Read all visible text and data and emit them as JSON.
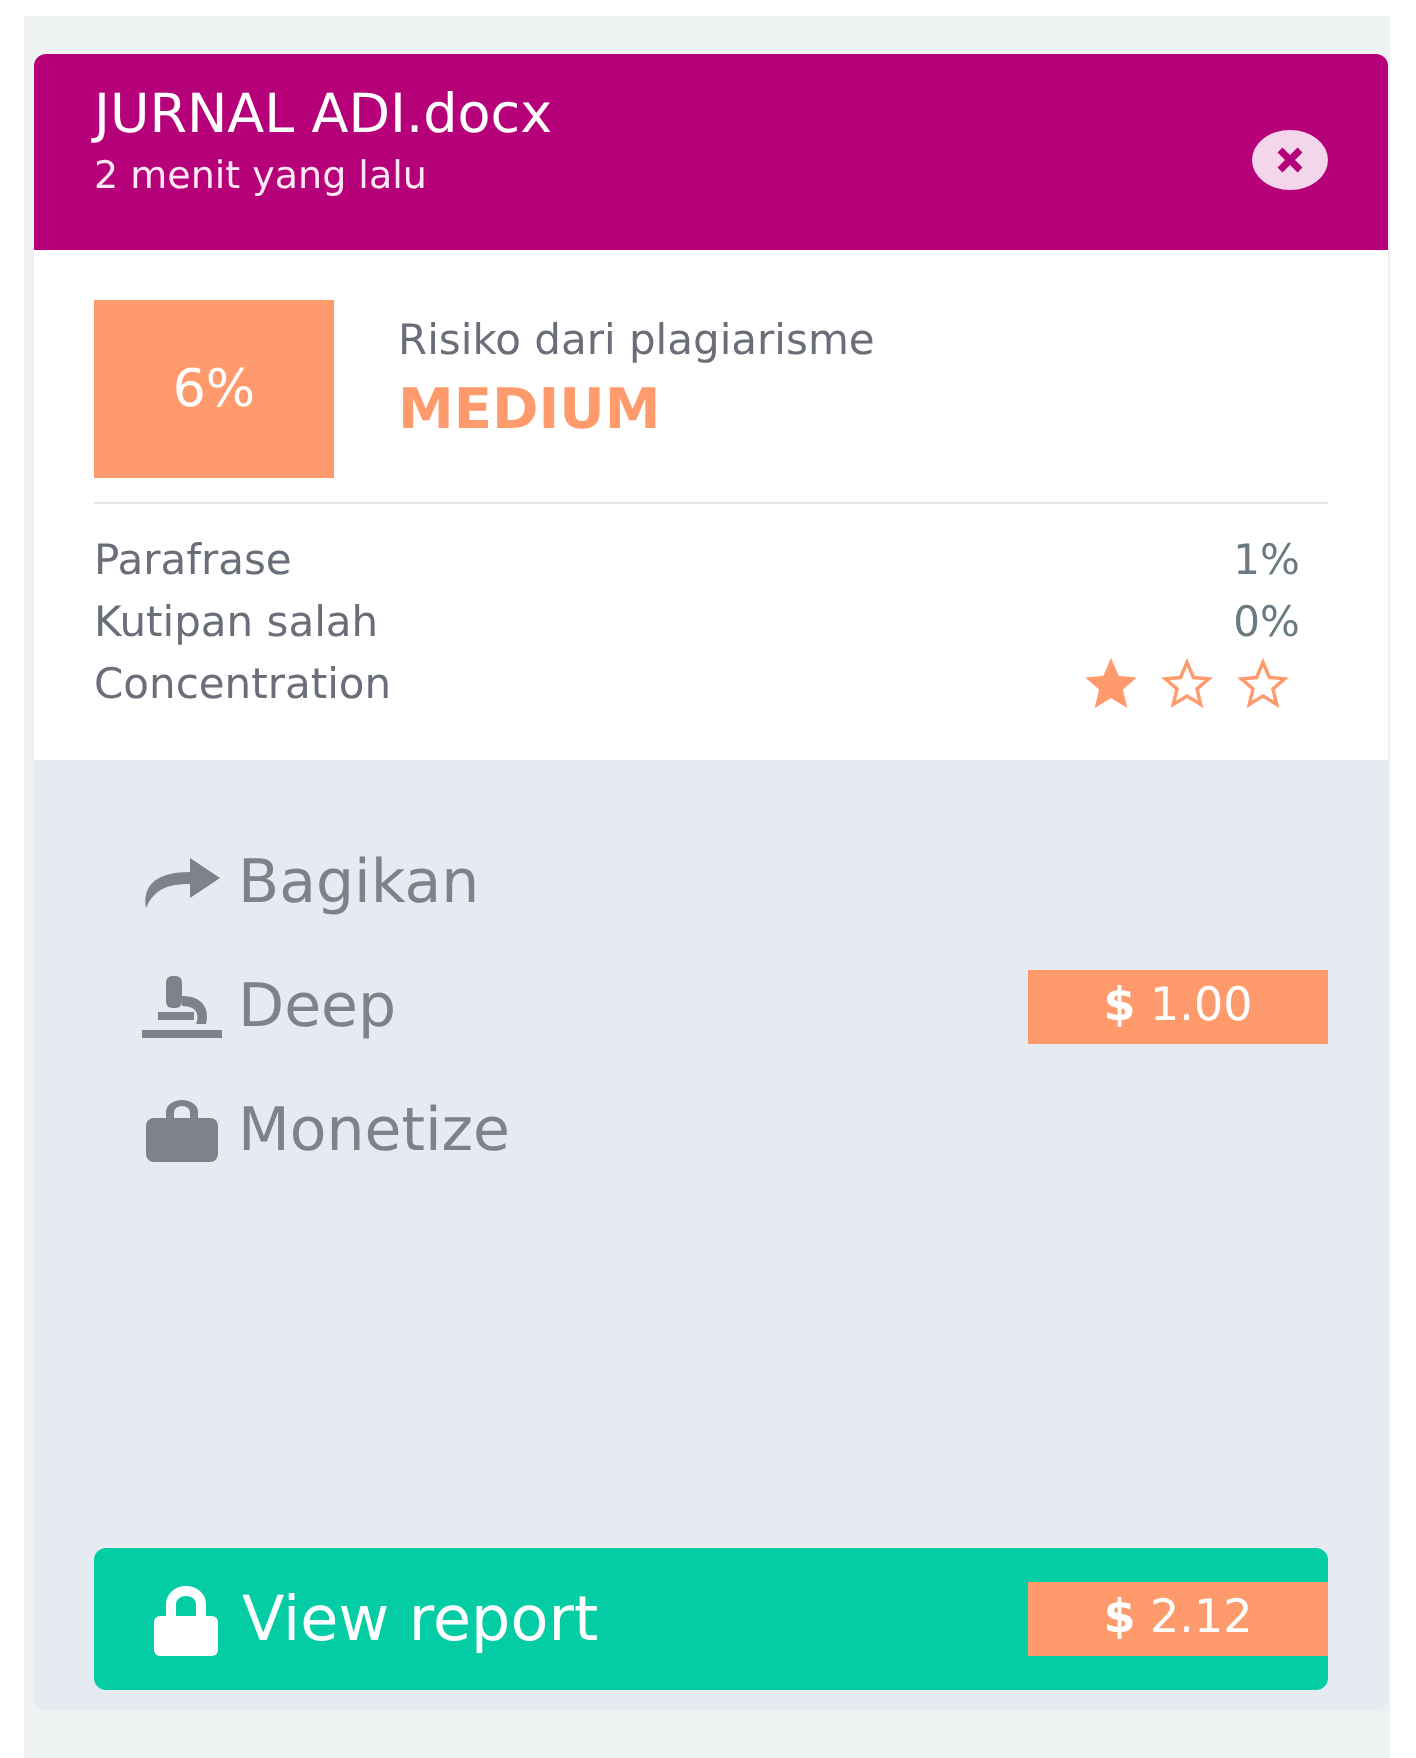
{
  "card": {
    "title": "JURNAL ADI.docx",
    "subtitle": "2 menit yang lalu"
  },
  "score": {
    "percent": "6%",
    "label": "Risiko dari plagiarisme",
    "level_text": "MEDIUM"
  },
  "metrics": [
    {
      "kind": "text",
      "label": "Parafrase",
      "value": "1%"
    },
    {
      "kind": "text",
      "label": "Kutipan salah",
      "value": "0%"
    },
    {
      "kind": "stars",
      "label": "Concentration",
      "stars": 1
    }
  ],
  "actions": [
    {
      "kind": "share",
      "label": "Bagikan"
    },
    {
      "kind": "deep",
      "label": "Deep",
      "price": "**$** 1.00"
    },
    {
      "kind": "monetize",
      "label": "Monetize"
    }
  ],
  "report_button": {
    "label": "View report",
    "price": "**$** 2.12"
  }
}
